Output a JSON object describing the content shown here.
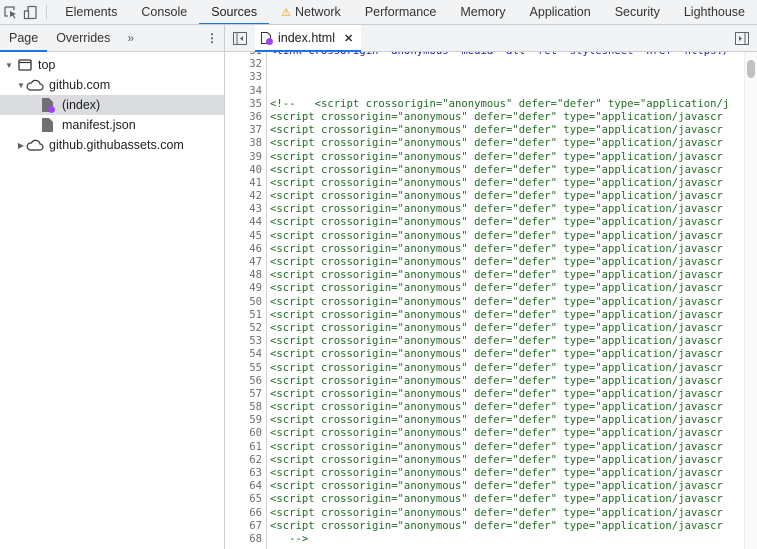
{
  "topbar": {
    "tabs": [
      {
        "label": "Elements",
        "active": false
      },
      {
        "label": "Console",
        "active": false
      },
      {
        "label": "Sources",
        "active": true
      },
      {
        "label": "Network",
        "active": false,
        "warning": true
      },
      {
        "label": "Performance",
        "active": false
      },
      {
        "label": "Memory",
        "active": false
      },
      {
        "label": "Application",
        "active": false
      },
      {
        "label": "Security",
        "active": false
      },
      {
        "label": "Lighthouse",
        "active": false
      }
    ]
  },
  "navigator": {
    "tabs": [
      {
        "label": "Page"
      },
      {
        "label": "Overrides"
      }
    ],
    "more": "»",
    "tree": {
      "top": "top",
      "domain1": "github.com",
      "file1": "(index)",
      "file2": "manifest.json",
      "domain2": "github.githubassets.com"
    }
  },
  "editor": {
    "file_tab": "index.html",
    "partial_line": "<link crossorigin=\"anonymous\" media=\"all\" rel=\"stylesheet\" href=\"https:/",
    "lines": [
      {
        "n": "32",
        "t": ""
      },
      {
        "n": "33",
        "t": ""
      },
      {
        "n": "34",
        "t": ""
      },
      {
        "n": "35",
        "t": "<!--   <script crossorigin=\"anonymous\" defer=\"defer\" type=\"application/j"
      },
      {
        "n": "36",
        "t": "<script crossorigin=\"anonymous\" defer=\"defer\" type=\"application/javascr"
      },
      {
        "n": "37",
        "t": "<script crossorigin=\"anonymous\" defer=\"defer\" type=\"application/javascr"
      },
      {
        "n": "38",
        "t": "<script crossorigin=\"anonymous\" defer=\"defer\" type=\"application/javascr"
      },
      {
        "n": "39",
        "t": "<script crossorigin=\"anonymous\" defer=\"defer\" type=\"application/javascr"
      },
      {
        "n": "40",
        "t": "<script crossorigin=\"anonymous\" defer=\"defer\" type=\"application/javascr"
      },
      {
        "n": "41",
        "t": "<script crossorigin=\"anonymous\" defer=\"defer\" type=\"application/javascr"
      },
      {
        "n": "42",
        "t": "<script crossorigin=\"anonymous\" defer=\"defer\" type=\"application/javascr"
      },
      {
        "n": "43",
        "t": "<script crossorigin=\"anonymous\" defer=\"defer\" type=\"application/javascr"
      },
      {
        "n": "44",
        "t": "<script crossorigin=\"anonymous\" defer=\"defer\" type=\"application/javascr"
      },
      {
        "n": "45",
        "t": "<script crossorigin=\"anonymous\" defer=\"defer\" type=\"application/javascr"
      },
      {
        "n": "46",
        "t": "<script crossorigin=\"anonymous\" defer=\"defer\" type=\"application/javascr"
      },
      {
        "n": "47",
        "t": "<script crossorigin=\"anonymous\" defer=\"defer\" type=\"application/javascr"
      },
      {
        "n": "48",
        "t": "<script crossorigin=\"anonymous\" defer=\"defer\" type=\"application/javascr"
      },
      {
        "n": "49",
        "t": "<script crossorigin=\"anonymous\" defer=\"defer\" type=\"application/javascr"
      },
      {
        "n": "50",
        "t": "<script crossorigin=\"anonymous\" defer=\"defer\" type=\"application/javascr"
      },
      {
        "n": "51",
        "t": "<script crossorigin=\"anonymous\" defer=\"defer\" type=\"application/javascr"
      },
      {
        "n": "52",
        "t": "<script crossorigin=\"anonymous\" defer=\"defer\" type=\"application/javascr"
      },
      {
        "n": "53",
        "t": "<script crossorigin=\"anonymous\" defer=\"defer\" type=\"application/javascr"
      },
      {
        "n": "54",
        "t": "<script crossorigin=\"anonymous\" defer=\"defer\" type=\"application/javascr"
      },
      {
        "n": "55",
        "t": "<script crossorigin=\"anonymous\" defer=\"defer\" type=\"application/javascr"
      },
      {
        "n": "56",
        "t": "<script crossorigin=\"anonymous\" defer=\"defer\" type=\"application/javascr"
      },
      {
        "n": "57",
        "t": "<script crossorigin=\"anonymous\" defer=\"defer\" type=\"application/javascr"
      },
      {
        "n": "58",
        "t": "<script crossorigin=\"anonymous\" defer=\"defer\" type=\"application/javascr"
      },
      {
        "n": "59",
        "t": "<script crossorigin=\"anonymous\" defer=\"defer\" type=\"application/javascr"
      },
      {
        "n": "60",
        "t": "<script crossorigin=\"anonymous\" defer=\"defer\" type=\"application/javascr"
      },
      {
        "n": "61",
        "t": "<script crossorigin=\"anonymous\" defer=\"defer\" type=\"application/javascr"
      },
      {
        "n": "62",
        "t": "<script crossorigin=\"anonymous\" defer=\"defer\" type=\"application/javascr"
      },
      {
        "n": "63",
        "t": "<script crossorigin=\"anonymous\" defer=\"defer\" type=\"application/javascr"
      },
      {
        "n": "64",
        "t": "<script crossorigin=\"anonymous\" defer=\"defer\" type=\"application/javascr"
      },
      {
        "n": "65",
        "t": "<script crossorigin=\"anonymous\" defer=\"defer\" type=\"application/javascr"
      },
      {
        "n": "66",
        "t": "<script crossorigin=\"anonymous\" defer=\"defer\" type=\"application/javascr"
      },
      {
        "n": "67",
        "t": "<script crossorigin=\"anonymous\" defer=\"defer\" type=\"application/javascr"
      },
      {
        "n": "68",
        "t": "   -->"
      }
    ]
  },
  "colors": {
    "accent": "#1a73e8",
    "warning": "#f29900",
    "code_comment": "#236e25",
    "modified_dot": "#a142f4"
  }
}
